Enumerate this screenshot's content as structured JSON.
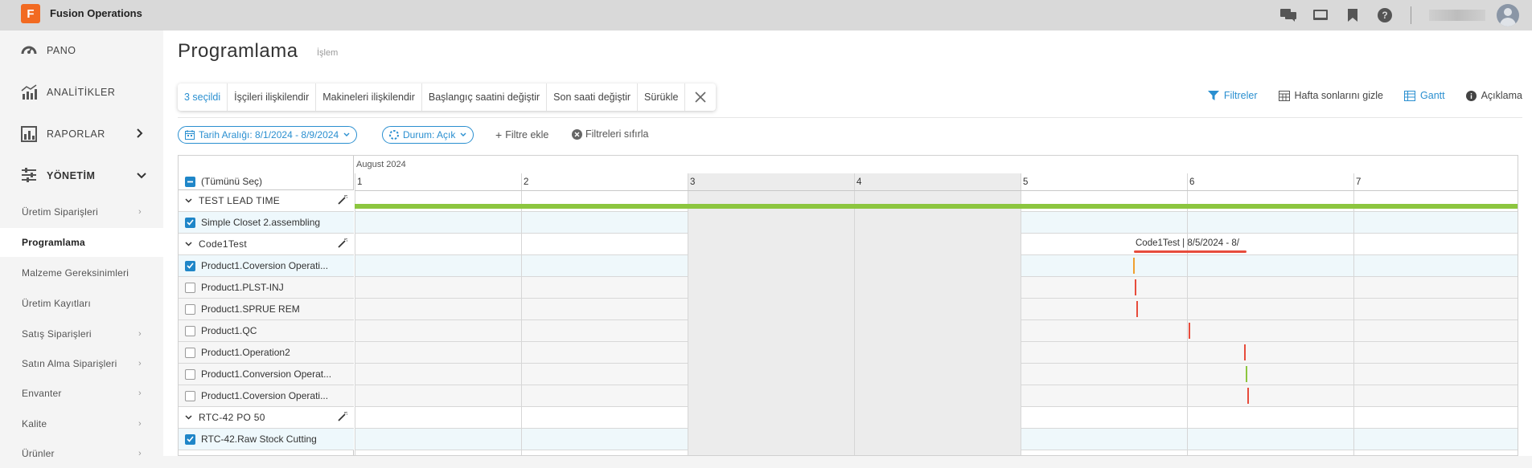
{
  "app": {
    "title": "Fusion Operations",
    "logo_letter": "F",
    "accent": "#f26a21"
  },
  "topbar": {
    "icons": [
      "chat-icon",
      "monitor-icon",
      "bookmark-icon",
      "help-icon",
      "avatar"
    ]
  },
  "sidebar": {
    "main": [
      {
        "label": "PANO",
        "icon": "gauge-icon"
      },
      {
        "label": "ANALİTİKLER",
        "icon": "analytics-icon"
      },
      {
        "label": "RAPORLAR",
        "icon": "reports-icon"
      },
      {
        "label": "YÖNETİM",
        "icon": "sliders-icon"
      }
    ],
    "sub": [
      {
        "label": "Üretim Siparişleri",
        "arrow": true
      },
      {
        "label": "Programlama",
        "arrow": false,
        "active": true
      },
      {
        "label": "Malzeme Gereksinimleri",
        "arrow": false
      },
      {
        "label": "Üretim Kayıtları",
        "arrow": false
      },
      {
        "label": "Satış Siparişleri",
        "arrow": true
      },
      {
        "label": "Satın Alma Siparişleri",
        "arrow": true
      },
      {
        "label": "Envanter",
        "arrow": true
      },
      {
        "label": "Kalite",
        "arrow": true
      },
      {
        "label": "Ürünler",
        "arrow": true
      }
    ]
  },
  "page": {
    "title": "Programlama",
    "subtitle": "İşlem"
  },
  "selection_bar": {
    "count": "3 seçildi",
    "actions": [
      "İşçileri ilişkilendir",
      "Makineleri ilişkilendir",
      "Başlangıç saatini değiştir",
      "Son saati değiştir",
      "Sürükle"
    ]
  },
  "toolbar_right": {
    "filters": "Filtreler",
    "hide_weekends": "Hafta sonlarını gizle",
    "gantt": "Gantt",
    "legend": "Açıklama"
  },
  "filters": {
    "date_range": "Tarih Aralığı: 8/1/2024 - 8/9/2024",
    "status": "Durum: Açık",
    "add": "Filtre ekle",
    "reset": "Filtreleri sıfırla"
  },
  "gantt": {
    "select_all": "(Tümünü Seç)",
    "month": "August 2024",
    "days": [
      "1",
      "2",
      "3",
      "4",
      "5",
      "6",
      "7"
    ],
    "weekend_days": [
      "3",
      "4"
    ],
    "rows": [
      {
        "type": "group",
        "label": "TEST LEAD TIME"
      },
      {
        "type": "task",
        "label": "Simple Closet 2.assembling",
        "checked": true
      },
      {
        "type": "group",
        "label": "Code1Test"
      },
      {
        "type": "task",
        "label": "Product1.Coversion Operati...",
        "checked": true
      },
      {
        "type": "task",
        "label": "Product1.PLST-INJ",
        "checked": false
      },
      {
        "type": "task",
        "label": "Product1.SPRUE REM",
        "checked": false
      },
      {
        "type": "task",
        "label": "Product1.QC",
        "checked": false
      },
      {
        "type": "task",
        "label": "Product1.Operation2",
        "checked": false
      },
      {
        "type": "task",
        "label": "Product1.Conversion Operat...",
        "checked": false
      },
      {
        "type": "task",
        "label": "Product1.Coversion Operati...",
        "checked": false
      },
      {
        "type": "group",
        "label": "RTC-42 PO 50"
      },
      {
        "type": "task",
        "label": "RTC-42.Raw Stock Cutting",
        "checked": true
      }
    ],
    "bar_label": "Code1Test | 8/5/2024 - 8/",
    "colors": {
      "green": "#8cc63f",
      "red": "#e74c3c",
      "orange": "#f0a030"
    }
  }
}
